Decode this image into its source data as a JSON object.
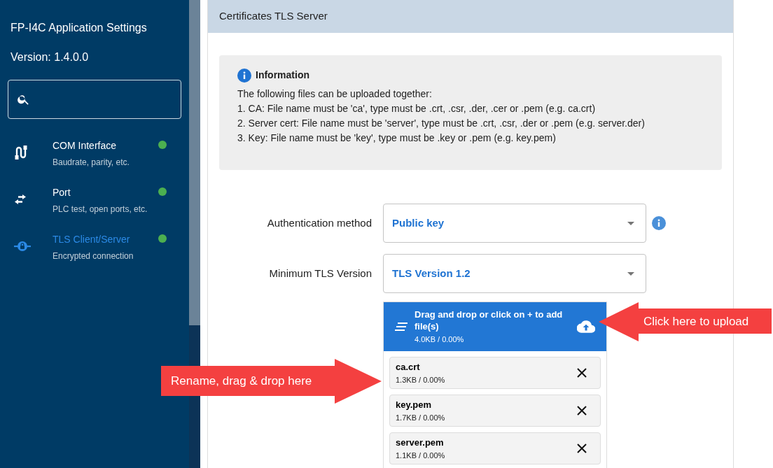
{
  "sidebar": {
    "title": "FP-I4C Application Settings",
    "version": "Version: 1.4.0.0",
    "items": [
      {
        "kind": "serial",
        "label": "COM Interface",
        "subtitle": "Baudrate, parity, etc.",
        "selected": false,
        "color": "#4caf50"
      },
      {
        "kind": "swap",
        "label": "Port",
        "subtitle": "PLC test, open ports, etc.",
        "selected": false,
        "color": "#4caf50"
      },
      {
        "kind": "lock",
        "label": "TLS Client/Server",
        "subtitle": "Encrypted connection",
        "selected": true,
        "color": "#4caf50"
      }
    ]
  },
  "panel": {
    "title": "Certificates TLS Server",
    "info": {
      "title": "Information",
      "lines": [
        "The following files can be uploaded together:",
        "1. CA: File name must be 'ca', type must be .crt, .csr, .der, .cer or .pem (e.g. ca.crt)",
        "2. Server cert: File name must be 'server', type must be .crt, .csr, .der or .pem (e.g. server.der)",
        "3. Key: File name must be 'key', type must be .key or .pem (e.g. key.pem)"
      ]
    },
    "fields": [
      {
        "label": "Authentication method",
        "value": "Public key",
        "info": true
      },
      {
        "label": "Minimum TLS Version",
        "value": "TLS Version 1.2",
        "info": false
      }
    ],
    "upload": {
      "title": "Drag and drop or click on + to add file(s)",
      "size": "4.0KB / 0.00%",
      "files": [
        {
          "name": "ca.crt",
          "size": "1.3KB / 0.00%"
        },
        {
          "name": "key.pem",
          "size": "1.7KB / 0.00%"
        },
        {
          "name": "server.pem",
          "size": "1.1KB / 0.00%"
        }
      ]
    }
  },
  "annotations": [
    {
      "text": "Click here to upload",
      "kind": "left"
    },
    {
      "text": "Rename, drag & drop here",
      "kind": "right"
    }
  ]
}
